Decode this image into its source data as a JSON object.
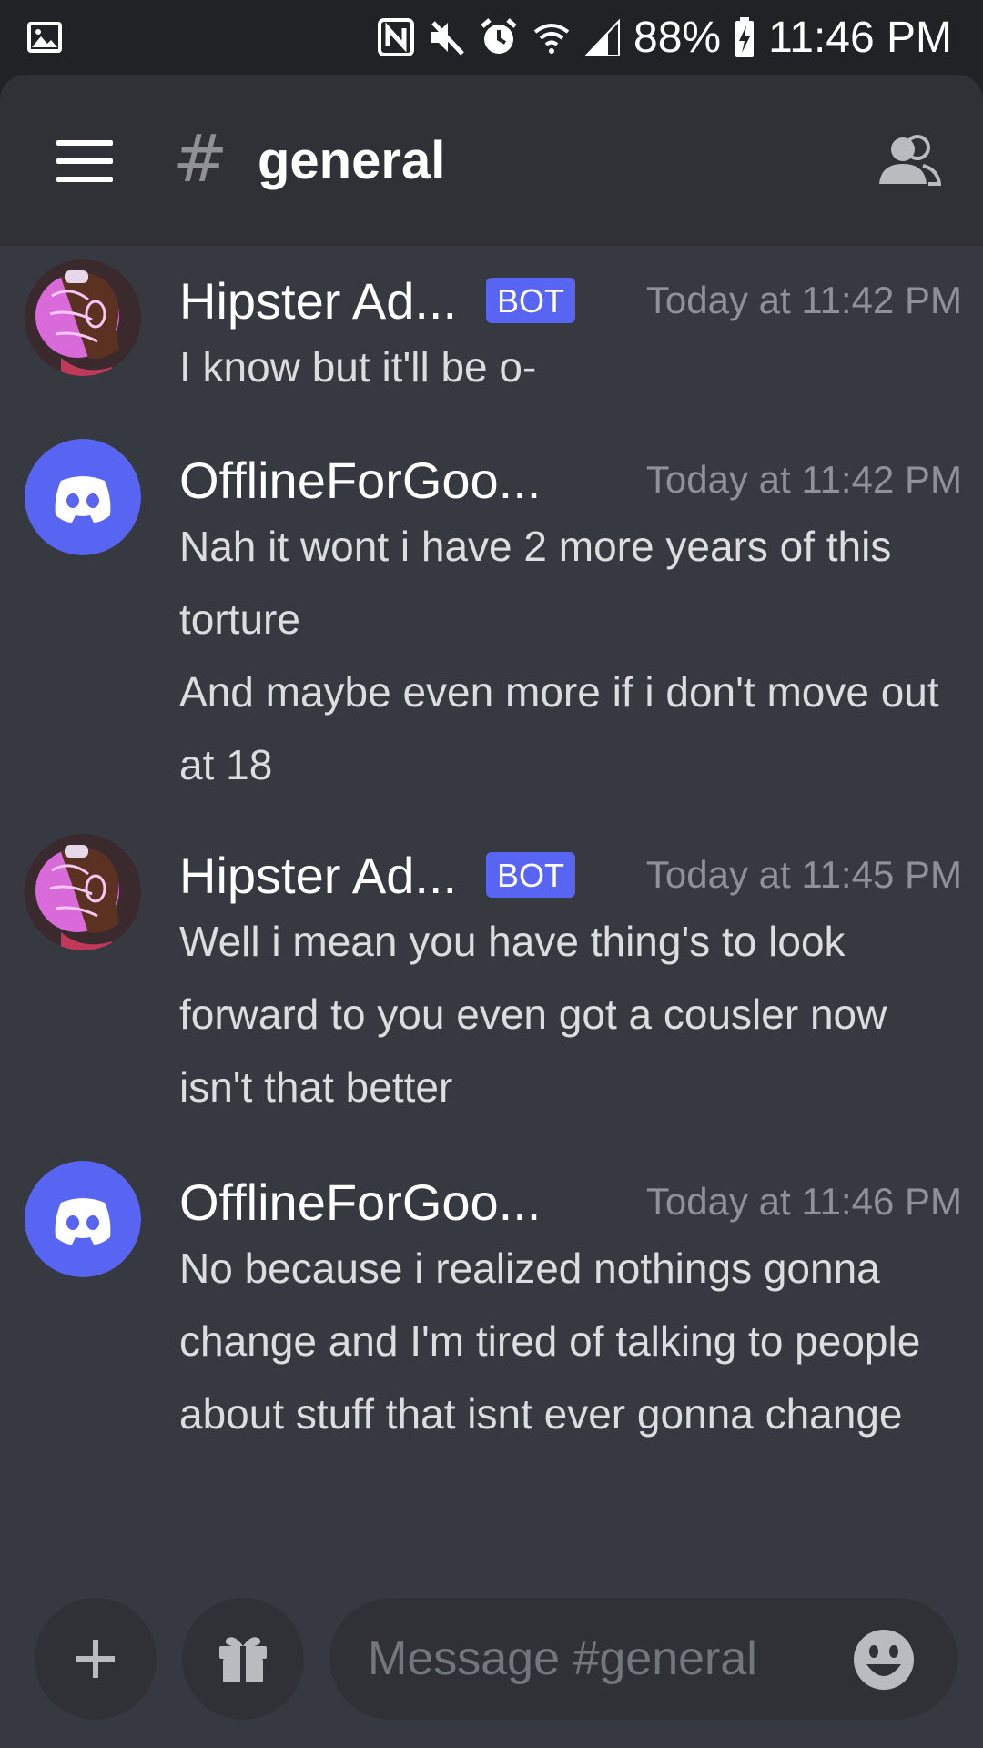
{
  "status_bar": {
    "battery": "88%",
    "time": "11:46 PM",
    "icons": [
      "gallery-icon",
      "nfc-icon",
      "mute-icon",
      "alarm-icon",
      "wifi-icon",
      "signal-icon",
      "battery-icon"
    ]
  },
  "header": {
    "channel_prefix": "#",
    "channel_name": "general",
    "icons": [
      "hamburger-menu-icon",
      "members-icon"
    ]
  },
  "messages": [
    {
      "author": "Hipster Ad...",
      "bot": true,
      "bot_label": "BOT",
      "timestamp": "Today at 11:42 PM",
      "avatar": "pink-sketch-avatar",
      "lines": [
        "I know but it'll be o-"
      ]
    },
    {
      "author": "OfflineForGoo...",
      "bot": false,
      "timestamp": "Today at 11:42 PM",
      "avatar": "discord-default-avatar",
      "lines": [
        "Nah it wont i have 2 more years of this torture",
        "And maybe even more if i don't move out at 18"
      ]
    },
    {
      "author": "Hipster Ad...",
      "bot": true,
      "bot_label": "BOT",
      "timestamp": "Today at 11:45 PM",
      "avatar": "pink-sketch-avatar",
      "lines": [
        "Well i mean you have thing's to look forward to you even got a cousler now isn't that better"
      ]
    },
    {
      "author": "OfflineForGoo...",
      "bot": false,
      "timestamp": "Today at 11:46 PM",
      "avatar": "discord-default-avatar",
      "lines": [
        "No because i realized nothings gonna change and I'm tired of talking to people about stuff that isnt ever gonna change"
      ]
    }
  ],
  "composer": {
    "placeholder": "Message #general",
    "icons": [
      "plus-icon",
      "gift-icon",
      "emoji-icon"
    ]
  },
  "colors": {
    "background": "#36393f",
    "header": "#2f3136",
    "status_bar": "#202225",
    "blurple": "#5865f2",
    "timestamp": "#8e9297"
  }
}
